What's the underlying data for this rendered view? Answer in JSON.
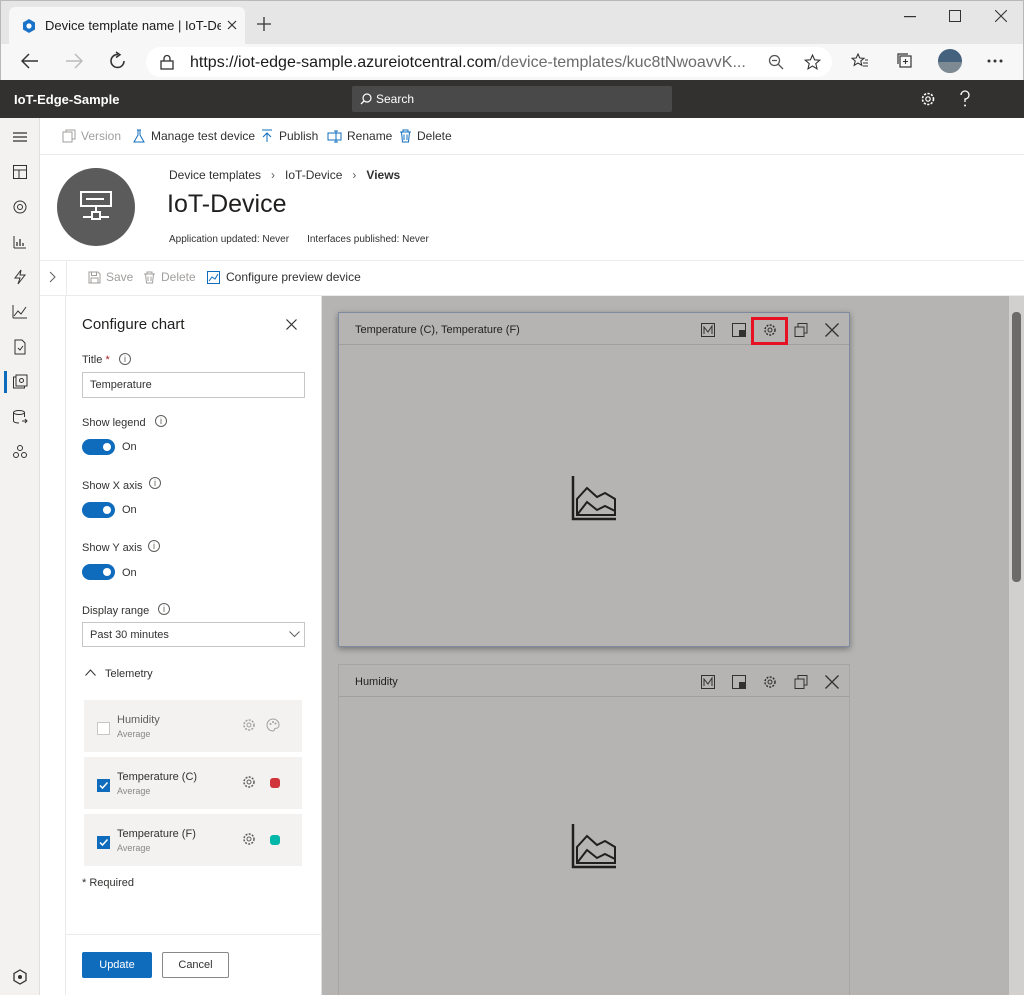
{
  "browser": {
    "tab_title": "Device template name | IoT-Devi",
    "url_host": "https://iot-edge-sample.azureiotcentral.com",
    "url_path": "/device-templates/kuc8tNwoavvK..."
  },
  "app": {
    "name": "IoT-Edge-Sample",
    "search_placeholder": "Search"
  },
  "toolbar": {
    "version": "Version",
    "manage_test_device": "Manage test device",
    "publish": "Publish",
    "rename": "Rename",
    "delete": "Delete"
  },
  "header": {
    "breadcrumb": [
      "Device templates",
      "IoT-Device",
      "Views"
    ],
    "title": "IoT-Device",
    "app_updated": "Application updated: Never",
    "interfaces_published": "Interfaces published: Never"
  },
  "view_toolbar": {
    "save": "Save",
    "delete": "Delete",
    "configure_preview": "Configure preview device"
  },
  "config": {
    "title": "Configure chart",
    "title_label": "Title",
    "required_mark": "*",
    "title_value": "Temperature",
    "show_legend_label": "Show legend",
    "show_legend_state": "On",
    "show_x_label": "Show X axis",
    "show_x_state": "On",
    "show_y_label": "Show Y axis",
    "show_y_state": "On",
    "display_range_label": "Display range",
    "display_range_value": "Past 30 minutes",
    "telemetry_label": "Telemetry",
    "telemetry": [
      {
        "name": "Humidity",
        "agg": "Average",
        "checked": false,
        "color": ""
      },
      {
        "name": "Temperature (C)",
        "agg": "Average",
        "checked": true,
        "color": "#d13438"
      },
      {
        "name": "Temperature (F)",
        "agg": "Average",
        "checked": true,
        "color": "#00b7a8"
      }
    ],
    "required_note": "* Required",
    "update": "Update",
    "cancel": "Cancel"
  },
  "tiles": [
    {
      "title": "Temperature (C), Temperature (F)",
      "highlighted_settings": true
    },
    {
      "title": "Humidity",
      "highlighted_settings": false
    }
  ]
}
